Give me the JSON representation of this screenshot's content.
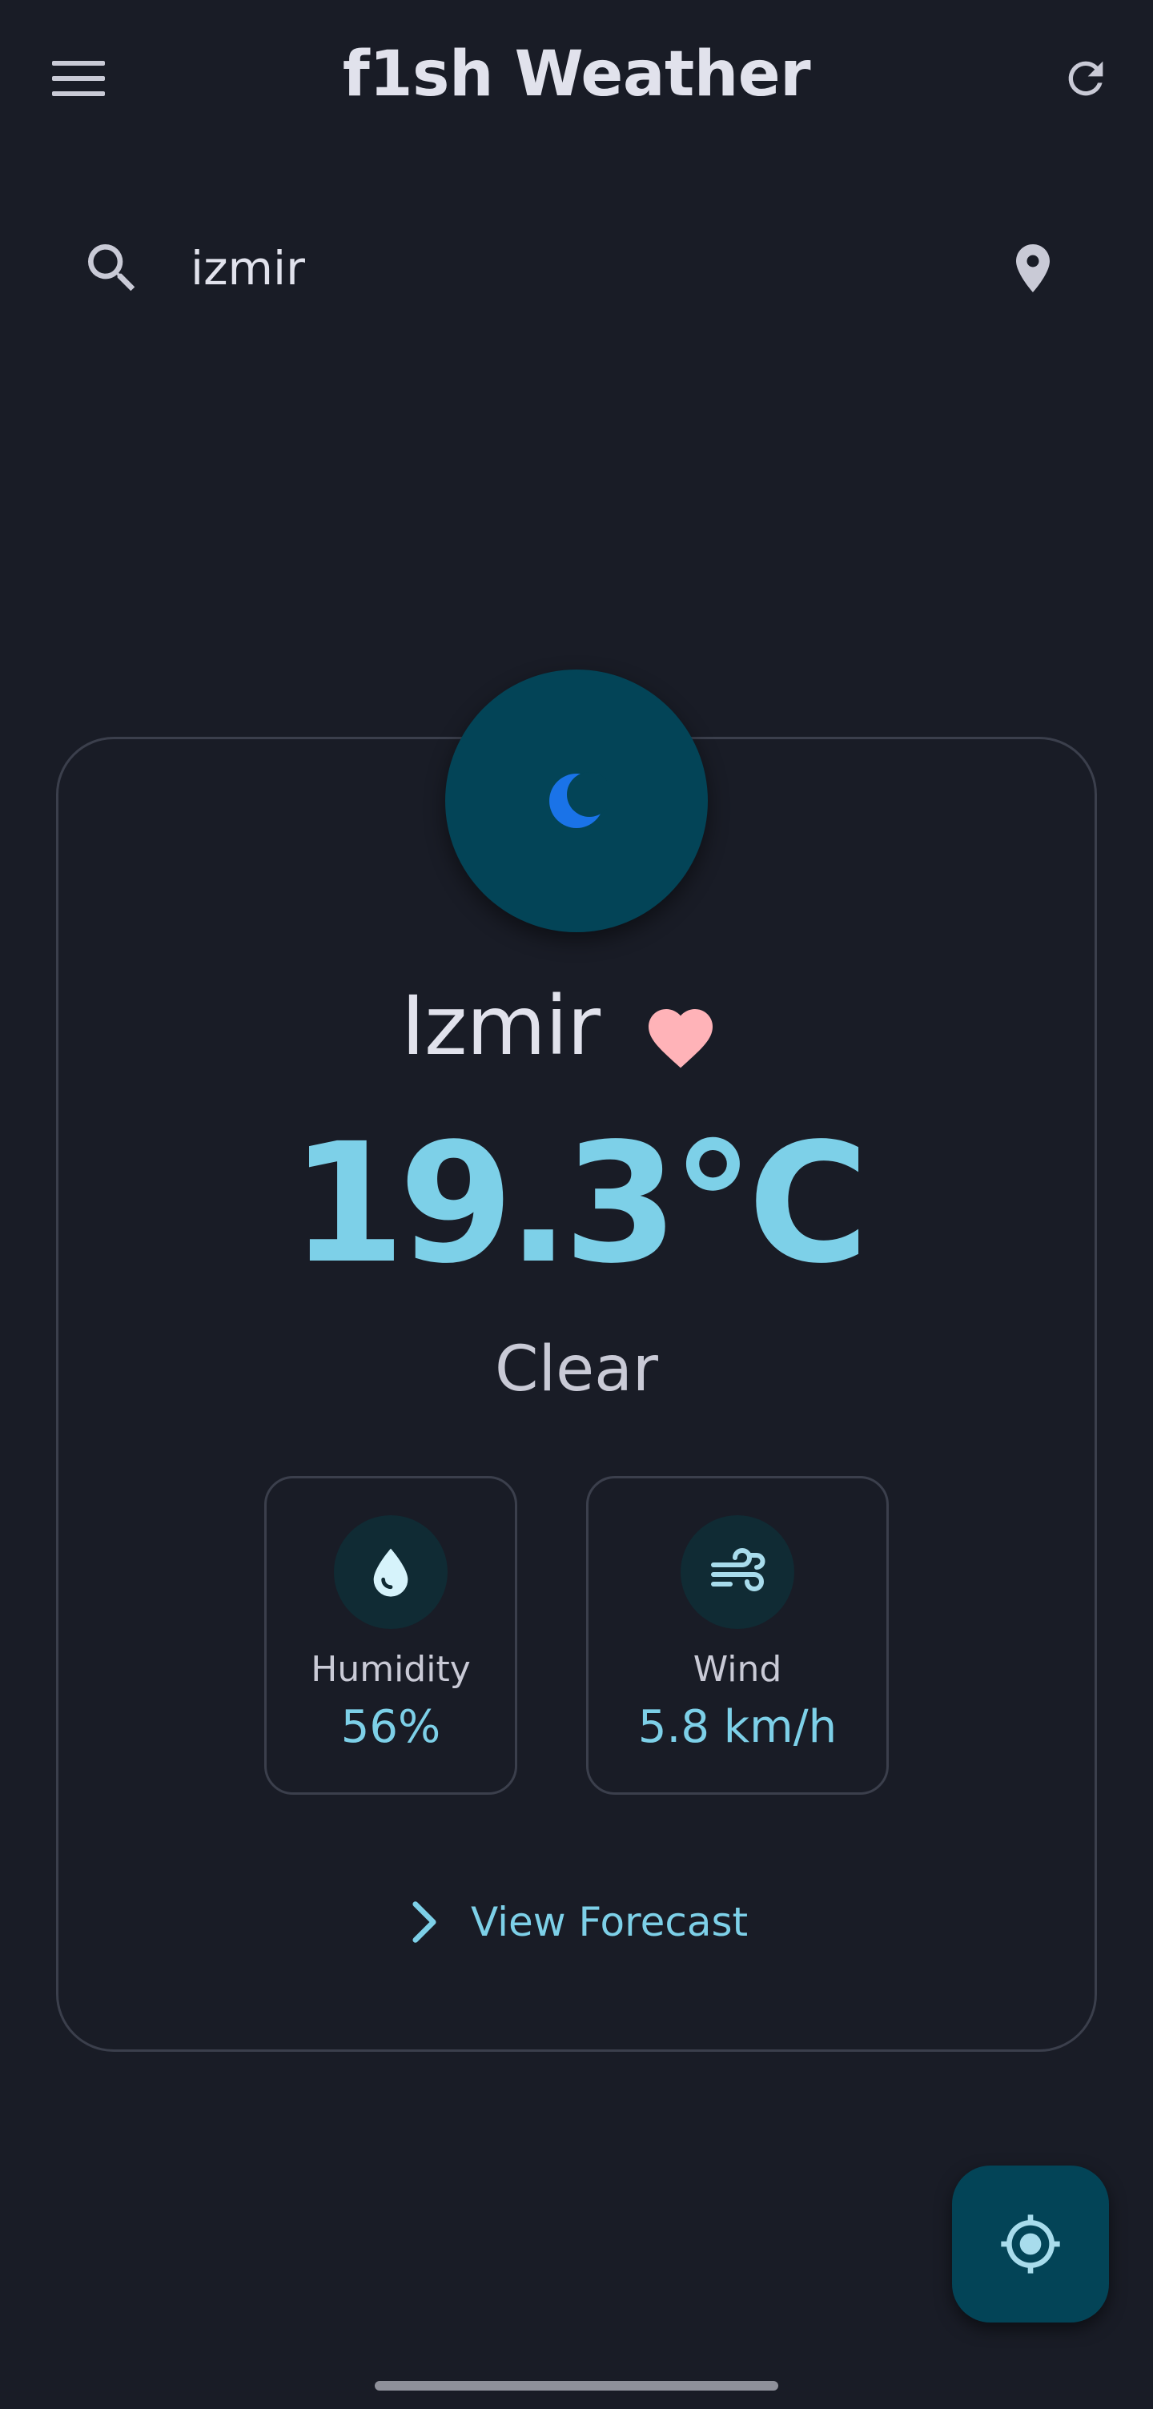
{
  "app_bar": {
    "title": "f1sh Weather",
    "menu_icon": "menu-icon",
    "refresh_icon": "refresh-icon"
  },
  "search": {
    "value": "izmir",
    "search_icon": "search-icon",
    "location_icon": "location-pin-icon"
  },
  "weather": {
    "condition_icon": "moon-icon",
    "city": "Izmir",
    "favorite_icon": "heart-icon",
    "temperature": "19.3°C",
    "condition": "Clear",
    "humidity": {
      "icon": "water-drop-icon",
      "label": "Humidity",
      "value": "56%"
    },
    "wind": {
      "icon": "wind-icon",
      "label": "Wind",
      "value": "5.8 km/h"
    },
    "forecast_link": "View Forecast"
  },
  "fab": {
    "icon": "my-location-icon"
  },
  "colors": {
    "background": "#191c26",
    "accent": "#7dd0e8",
    "container": "#034457",
    "favorite": "#ffb3b8",
    "moon": "#1a73e8",
    "outline": "#3b3f4c"
  }
}
